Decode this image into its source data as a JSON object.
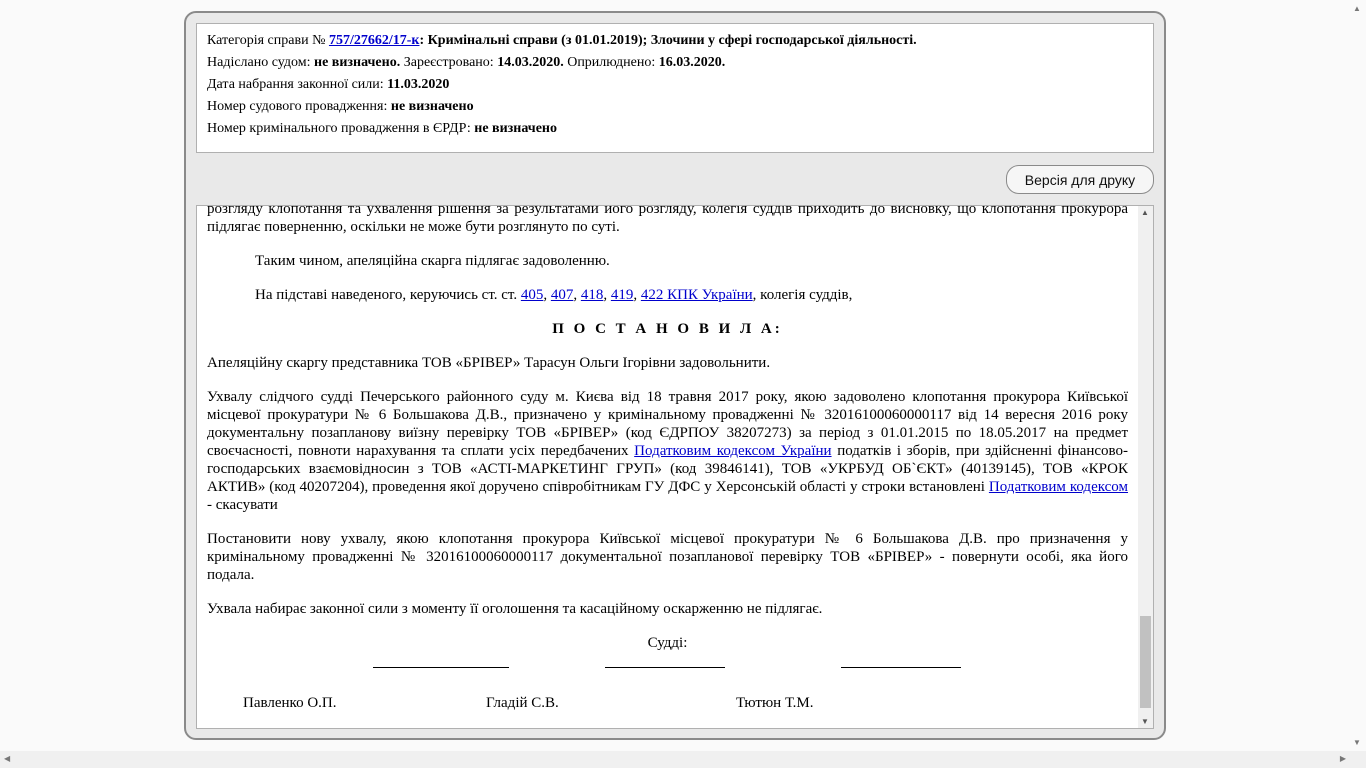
{
  "header": {
    "category_label": "Категорія справи №",
    "case_number": "757/27662/17-к",
    "category_value": ": Кримінальні справи (з 01.01.2019); Злочини у сфері господарської діяльності.",
    "sent_label": "Надіслано судом:",
    "sent_value": "не визначено.",
    "registered_label": "Зареєстровано:",
    "registered_value": "14.03.2020.",
    "published_label": "Оприлюднено:",
    "published_value": "16.03.2020.",
    "effective_label": "Дата набрання законної сили:",
    "effective_value": "11.03.2020",
    "court_proc_label": "Номер судового провадження:",
    "court_proc_value": "не визначено",
    "criminal_proc_label": "Номер кримінального провадження в ЄРДР:",
    "criminal_proc_value": "не визначено"
  },
  "print_button": "Версія для друку",
  "document": {
    "p1": "розгляду клопотання та ухвалення рішення за результатами його розгляду, колегія суддів приходить до висновку, що клопотання прокурора підлягає поверненню, оскільки не може бути розглянуто по суті.",
    "p2": "Таким чином, апеляційна скарга підлягає задоволенню.",
    "p3_start": "На підставі наведеного, керуючись ст. ст.",
    "links": [
      "405",
      "407",
      "418",
      "419",
      "422 КПК України"
    ],
    "sep": ",",
    "p3_end": ", колегія суддів,",
    "decided": "П О С Т А Н О В И Л А:",
    "p4": "Апеляційну скаргу представника ТОВ «БРІВЕР» Тарасун Ольги Ігорівни задовольнити.",
    "p5_a": "Ухвалу слідчого судді Печерського районного суду м. Києва від 18 травня 2017 року, якою задоволено клопотання прокурора Київської місцевої прокуратури № 6                    Большакова Д.В., призначено у кримінальному провадженні  № 32016100060000117 від 14 вересня 2016 року документальну позапланову виїзну перевірку ТОВ «БРІВЕР» (код ЄДРПОУ 38207273) за період з 01.01.2015 по 18.05.2017 на предмет своєчасності, повноти нарахування та сплати усіх передбачених",
    "p5_link1": "Податковим кодексом України",
    "p5_b": "податків і зборів, при здійсненні фінансово-господарських взаємовідносин з ТОВ «АСТІ-МАРКЕТИНГ ГРУП» (код 39846141), ТОВ «УКРБУД ОБ`ЄКТ» (40139145), ТОВ «КРОК АКТИВ» (код 40207204), проведення якої доручено співробітникам ГУ ДФС у Херсонській області у строки встановлені",
    "p5_link2": "Податковим кодексом",
    "p5_c": "- скасувати",
    "p6": "Постановити нову ухвалу, якою клопотання прокурора Київської місцевої прокуратури № 6 Большакова Д.В. про призначення у кримінальному провадженні                              № 32016100060000117 документальної позапланової перевірку ТОВ «БРІВЕР» -  повернути особі, яка його подала.",
    "p7": "Ухвала набирає законної сили з моменту її оголошення та касаційному оскарженню не підлягає.",
    "judges_label": "Судді:",
    "judges": [
      "Павленко О.П.",
      "Гладій С.В.",
      "Тютюн Т.М."
    ]
  }
}
